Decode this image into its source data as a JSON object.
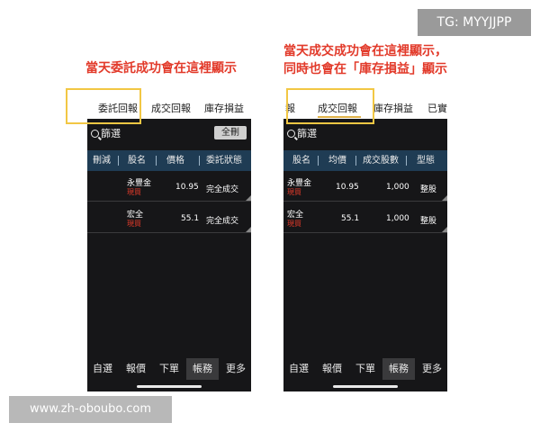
{
  "watermark_tg": "TG: MYYJJPP",
  "watermark_url": "www.zh-oboubo.com",
  "caption_left": "當天委託成功會在這裡顯示",
  "caption_right_line1": "當天成交成功會在這裡顯示，",
  "caption_right_line2": "同時也會在「庫存損益」顯示",
  "colors": {
    "caption_red": "#e23a2a",
    "highlight_yellow": "#f2c744",
    "header_navy": "#1f3c54",
    "phone_bg": "#161618"
  },
  "left_phone": {
    "tabs": [
      "委託回報",
      "成交回報",
      "庫存損益"
    ],
    "filter_label": "篩選",
    "delete_all": "全刪",
    "headers": [
      "刪減",
      "股名",
      "價格",
      "委託狀態"
    ],
    "rows": [
      {
        "name": "永豐金",
        "tag": "現買",
        "price": "10.95",
        "status": "完全成交"
      },
      {
        "name": "宏全",
        "tag": "現買",
        "price": "55.1",
        "status": "完全成交"
      }
    ],
    "nav": [
      "自選",
      "報價",
      "下單",
      "帳務",
      "更多"
    ]
  },
  "right_phone": {
    "tabs": [
      "報",
      "成交回報",
      "庫存損益",
      "已實"
    ],
    "filter_label": "篩選",
    "headers": [
      "股名",
      "均價",
      "成交股數",
      "型態"
    ],
    "rows": [
      {
        "name": "永豐金",
        "tag": "現買",
        "avg": "10.95",
        "shares": "1,000",
        "type": "整股"
      },
      {
        "name": "宏全",
        "tag": "現買",
        "avg": "55.1",
        "shares": "1,000",
        "type": "整股"
      }
    ],
    "nav": [
      "自選",
      "報價",
      "下單",
      "帳務",
      "更多"
    ]
  }
}
